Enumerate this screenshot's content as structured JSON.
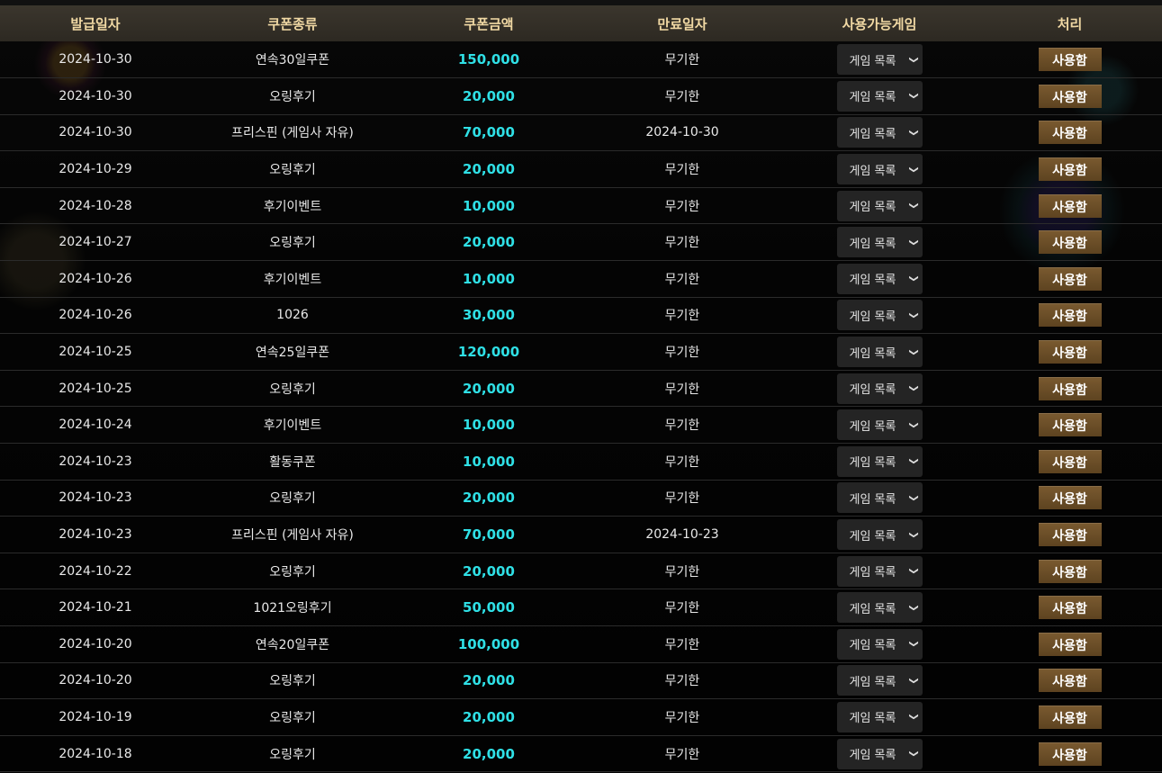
{
  "headers": [
    "발급일자",
    "쿠폰종류",
    "쿠폰금액",
    "만료일자",
    "사용가능게임",
    "처리"
  ],
  "select_label": "게임 목록",
  "button_label": "사용함",
  "rows": [
    {
      "date": "2024-10-30",
      "type": "연속30일쿠폰",
      "amount": "150,000",
      "expiry": "무기한"
    },
    {
      "date": "2024-10-30",
      "type": "오링후기",
      "amount": "20,000",
      "expiry": "무기한"
    },
    {
      "date": "2024-10-30",
      "type": "프리스핀 (게임사 자유)",
      "amount": "70,000",
      "expiry": "2024-10-30"
    },
    {
      "date": "2024-10-29",
      "type": "오링후기",
      "amount": "20,000",
      "expiry": "무기한"
    },
    {
      "date": "2024-10-28",
      "type": "후기이벤트",
      "amount": "10,000",
      "expiry": "무기한"
    },
    {
      "date": "2024-10-27",
      "type": "오링후기",
      "amount": "20,000",
      "expiry": "무기한"
    },
    {
      "date": "2024-10-26",
      "type": "후기이벤트",
      "amount": "10,000",
      "expiry": "무기한"
    },
    {
      "date": "2024-10-26",
      "type": "1026",
      "amount": "30,000",
      "expiry": "무기한"
    },
    {
      "date": "2024-10-25",
      "type": "연속25일쿠폰",
      "amount": "120,000",
      "expiry": "무기한"
    },
    {
      "date": "2024-10-25",
      "type": "오링후기",
      "amount": "20,000",
      "expiry": "무기한"
    },
    {
      "date": "2024-10-24",
      "type": "후기이벤트",
      "amount": "10,000",
      "expiry": "무기한"
    },
    {
      "date": "2024-10-23",
      "type": "활동쿠폰",
      "amount": "10,000",
      "expiry": "무기한"
    },
    {
      "date": "2024-10-23",
      "type": "오링후기",
      "amount": "20,000",
      "expiry": "무기한"
    },
    {
      "date": "2024-10-23",
      "type": "프리스핀 (게임사 자유)",
      "amount": "70,000",
      "expiry": "2024-10-23"
    },
    {
      "date": "2024-10-22",
      "type": "오링후기",
      "amount": "20,000",
      "expiry": "무기한"
    },
    {
      "date": "2024-10-21",
      "type": "1021오링후기",
      "amount": "50,000",
      "expiry": "무기한"
    },
    {
      "date": "2024-10-20",
      "type": "연속20일쿠폰",
      "amount": "100,000",
      "expiry": "무기한"
    },
    {
      "date": "2024-10-20",
      "type": "오링후기",
      "amount": "20,000",
      "expiry": "무기한"
    },
    {
      "date": "2024-10-19",
      "type": "오링후기",
      "amount": "20,000",
      "expiry": "무기한"
    },
    {
      "date": "2024-10-18",
      "type": "오링후기",
      "amount": "20,000",
      "expiry": "무기한"
    }
  ],
  "colors": {
    "header_text": "#f1d9a4",
    "amount_text": "#2fe0e6",
    "button_bg": "#6b4e28"
  }
}
